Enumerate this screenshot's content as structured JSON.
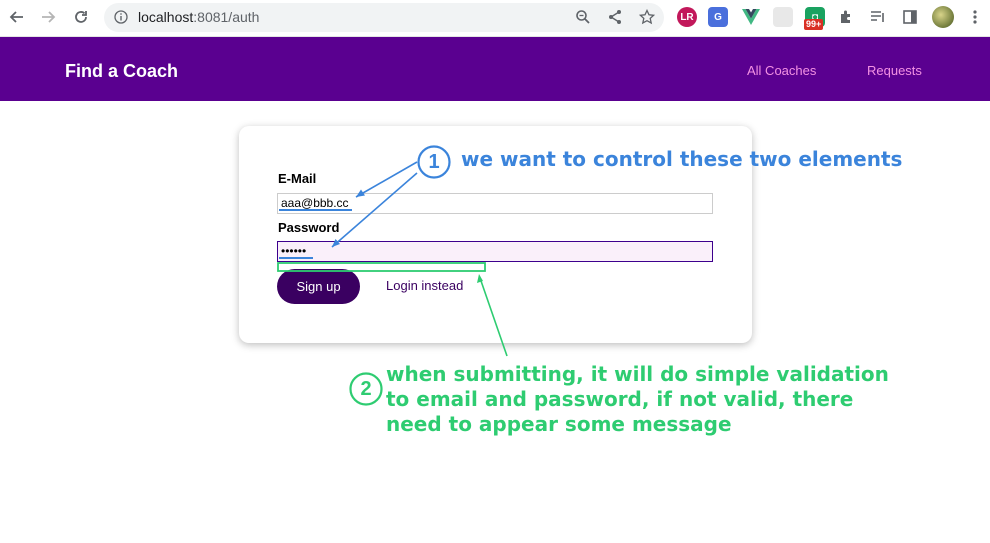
{
  "browser": {
    "url_host": "localhost",
    "url_rest": ":8081/auth",
    "extension_badge": "99+"
  },
  "app": {
    "brand": "Find a Coach",
    "nav": [
      "All Coaches",
      "Requests"
    ]
  },
  "form": {
    "email_label": "E-Mail",
    "email_value": "aaa@bbb.cc",
    "password_label": "Password",
    "password_value": "••••••",
    "signup_label": "Sign up",
    "login_label": "Login instead"
  },
  "annotations": {
    "one_number": "1",
    "one_text": "we want to control these two elements",
    "two_number": "2",
    "two_lines": [
      "when submitting, it will do simple validation",
      "to email and password, if not valid, there",
      "need to appear some message"
    ],
    "blue": "#3b84db",
    "green": "#2ecc71"
  },
  "colors": {
    "header": "#5a0090",
    "nav_link": "#f391e3",
    "button": "#3a0061"
  }
}
